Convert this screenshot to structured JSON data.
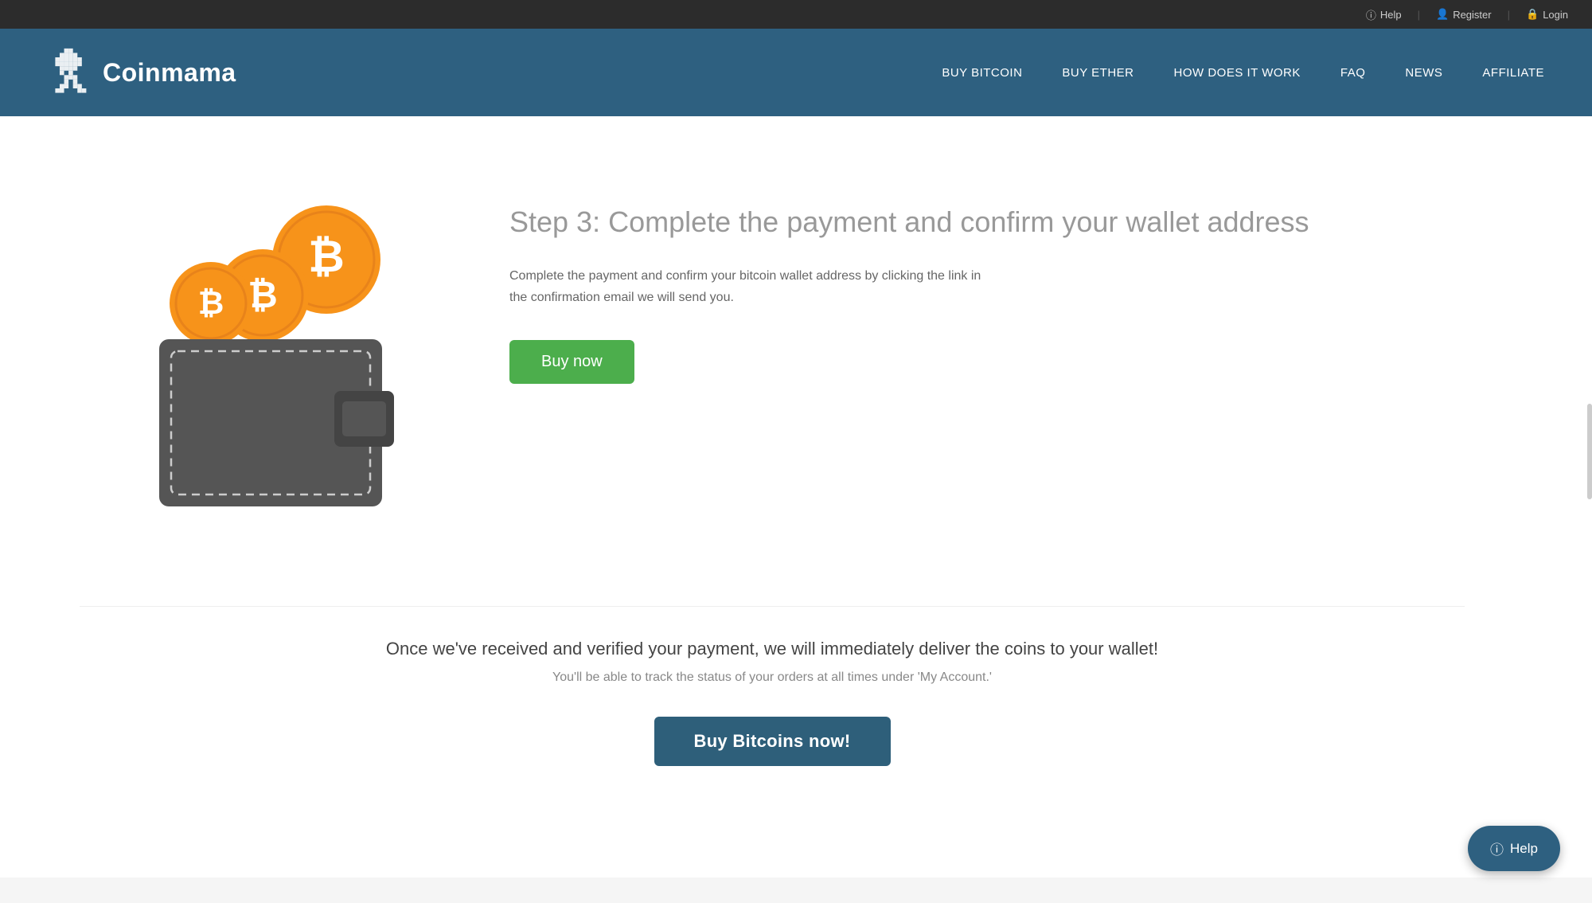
{
  "topbar": {
    "help_label": "Help",
    "register_label": "Register",
    "login_label": "Login"
  },
  "header": {
    "logo_text_regular": "Coin",
    "logo_text_bold": "mama",
    "nav": {
      "items": [
        {
          "label": "BUY BITCOIN",
          "id": "buy-bitcoin"
        },
        {
          "label": "BUY ETHER",
          "id": "buy-ether"
        },
        {
          "label": "HOW DOES IT WORK",
          "id": "how-it-works"
        },
        {
          "label": "FAQ",
          "id": "faq"
        },
        {
          "label": "NEWS",
          "id": "news"
        },
        {
          "label": "AFFILIATE",
          "id": "affiliate"
        }
      ]
    }
  },
  "main": {
    "step": {
      "title": "Step 3: Complete the payment and confirm your wallet address",
      "description": "Complete the payment and confirm your bitcoin wallet address by clicking the link in the confirmation email we will send you.",
      "buy_now_label": "Buy now"
    },
    "cta": {
      "main_text": "Once we've received and verified your payment, we will immediately deliver the coins to your wallet!",
      "sub_text": "You'll be able to track the status of your orders at all times under 'My Account.'",
      "button_label": "Buy Bitcoins now!"
    }
  },
  "help_fab": {
    "label": "Help"
  },
  "colors": {
    "header_bg": "#2e6080",
    "topbar_bg": "#2c2c2c",
    "nav_text": "#ffffff",
    "buy_now_green": "#4cae4c",
    "buy_bitcoins_dark": "#2e5f7a",
    "bitcoin_orange": "#f7931a",
    "wallet_dark": "#555555"
  }
}
